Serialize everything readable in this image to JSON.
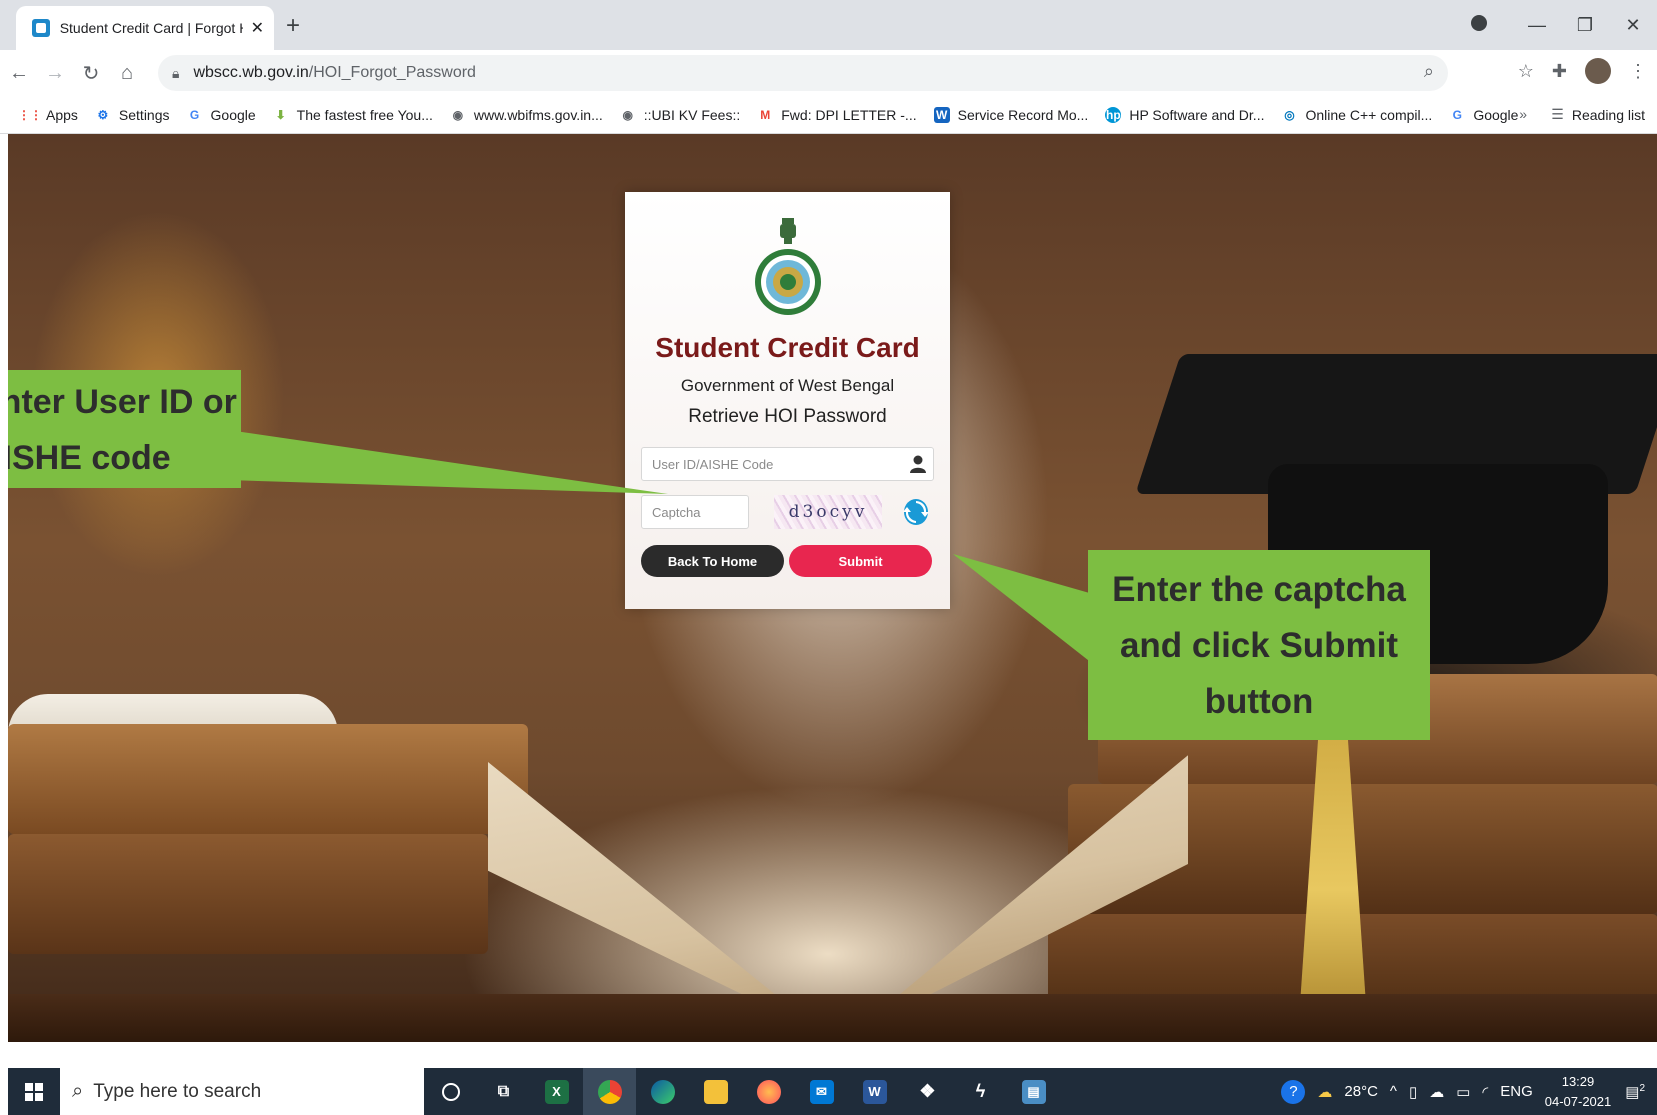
{
  "browser": {
    "tab_title": "Student Credit Card | Forgot HOI",
    "tab_close": "✕",
    "new_tab": "+",
    "url_host": "wbscc.wb.gov.in",
    "url_path": "/HOI_Forgot_Password",
    "window_minimize": "—",
    "window_restore": "❐",
    "window_close": "✕"
  },
  "bookmarks": {
    "items": [
      {
        "label": "Apps",
        "icon": "apps-grid-icon",
        "color": "#ea4335"
      },
      {
        "label": "Settings",
        "icon": "gear-icon",
        "color": "#1a73e8"
      },
      {
        "label": "Google",
        "icon": "google-icon",
        "color": "#4285f4"
      },
      {
        "label": "The fastest free You...",
        "icon": "download-arrow-icon",
        "color": "#7cb342"
      },
      {
        "label": "www.wbifms.gov.in...",
        "icon": "globe-icon",
        "color": "#5f6368"
      },
      {
        "label": "::UBI KV Fees::",
        "icon": "globe-icon",
        "color": "#5f6368"
      },
      {
        "label": "Fwd: DPI LETTER -...",
        "icon": "gmail-icon",
        "color": "#ea4335"
      },
      {
        "label": "Service Record Mo...",
        "icon": "word-icon",
        "color": "#1565c0"
      },
      {
        "label": "HP Software and Dr...",
        "icon": "hp-icon",
        "color": "#0096d6"
      },
      {
        "label": "Online C++ compil...",
        "icon": "compiler-icon",
        "color": "#0277bd"
      },
      {
        "label": "Google",
        "icon": "google-icon",
        "color": "#4285f4"
      }
    ],
    "more": "»",
    "reading_list": "Reading list"
  },
  "card": {
    "title": "Student Credit Card",
    "subtitle": "Government of West Bengal",
    "heading": "Retrieve HOI Password",
    "userid_placeholder": "User ID/AISHE Code",
    "captcha_placeholder": "Captcha",
    "captcha_text": "d3ocyv",
    "back_label": "Back To Home",
    "submit_label": "Submit",
    "title_color": "#7a1a1a",
    "submit_color": "#e8264f"
  },
  "annotations": {
    "left_line1": "Enter User ID or",
    "left_line2": "AISHE code",
    "right_line1": "Enter the captcha",
    "right_line2": "and click Submit",
    "right_line3": "button",
    "color": "#7dbe42"
  },
  "taskbar": {
    "search_placeholder": "Type here to search",
    "weather": "28°C",
    "language": "ENG",
    "time": "13:29",
    "date": "04-07-2021",
    "notification_count": "2"
  }
}
